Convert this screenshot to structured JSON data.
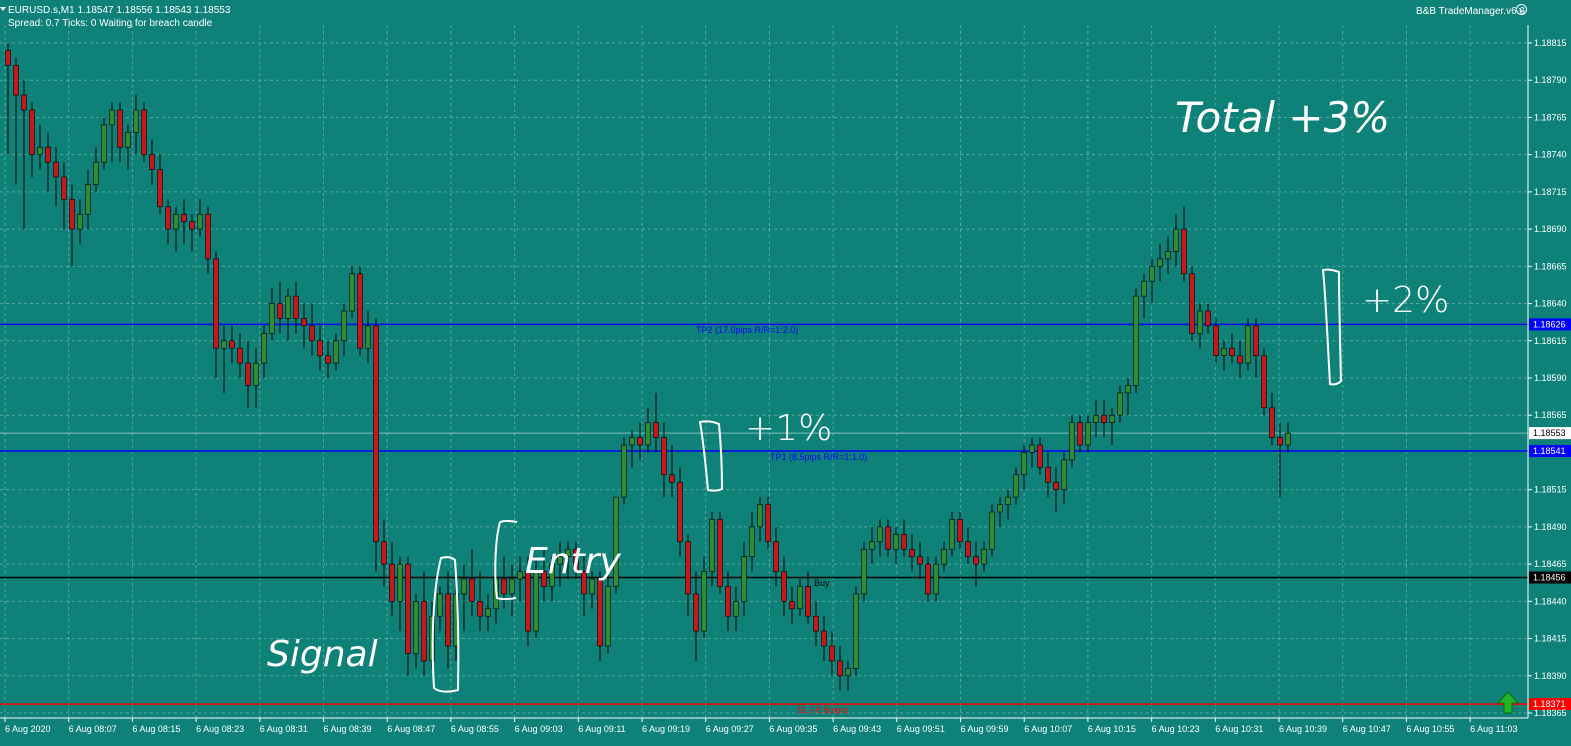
{
  "header": {
    "line1": "EURUSD.s,M1  1.18547 1.18556 1.18543 1.18553",
    "line2": "Spread: 0.7  Ticks: 0  Waiting for breach candle",
    "trade_manager": "B&B TradeManager.v6.6"
  },
  "colors": {
    "background": "#0e8279",
    "bull_candle": "#2e8b3a",
    "bear_candle": "#c8161d",
    "wick": "#000000",
    "grid": "#8fc7c0",
    "tp_line": "#0000ff",
    "sl_line": "#ff0000",
    "entry_line": "#000000",
    "handwriting": "#ffffff"
  },
  "price_axis": {
    "labels": [
      "1.18815",
      "1.18790",
      "1.18765",
      "1.18740",
      "1.18715",
      "1.18690",
      "1.18665",
      "1.18640",
      "1.18615",
      "1.18590",
      "1.18565",
      "1.18515",
      "1.18490",
      "1.18465",
      "1.18440",
      "1.18415",
      "1.18390",
      "1.18365"
    ],
    "top_price": 1.18815,
    "bottom_price": 1.18365
  },
  "time_axis": {
    "labels": [
      "6 Aug 2020",
      "6 Aug 08:07",
      "6 Aug 08:15",
      "6 Aug 08:23",
      "6 Aug 08:31",
      "6 Aug 08:39",
      "6 Aug 08:47",
      "6 Aug 08:55",
      "6 Aug 09:03",
      "6 Aug 09:11",
      "6 Aug 09:19",
      "6 Aug 09:27",
      "6 Aug 09:35",
      "6 Aug 09:43",
      "6 Aug 09:51",
      "6 Aug 09:59",
      "6 Aug 10:07",
      "6 Aug 10:15",
      "6 Aug 10:23",
      "6 Aug 10:31",
      "6 Aug 10:39",
      "6 Aug 10:47",
      "6 Aug 10:55",
      "6 Aug 11:03"
    ]
  },
  "levels": {
    "tp2": {
      "price": 1.18626,
      "price_label": "1.18626",
      "label": "TP2 (17.0pips R/R=1:2.0)"
    },
    "tp1": {
      "price": 1.18541,
      "price_label": "1.18541",
      "label": "TP1 (8.5pips R/R=1:1.0)"
    },
    "entry": {
      "price": 1.18456,
      "price_label": "1.18456",
      "label": "Buy"
    },
    "sl": {
      "price": 1.18371,
      "price_label": "1.18371",
      "label": "SL (-8.5pips)"
    },
    "current": {
      "price": 1.18553,
      "price_label": "1.18553"
    }
  },
  "annotations": {
    "total": "Total +3%",
    "tp2_gain": "+2%",
    "tp1_gain": "+1%",
    "entry": "Entry",
    "signal": "Signal"
  },
  "chart_data": {
    "type": "candlestick",
    "symbol": "EURUSD.s",
    "timeframe": "M1",
    "ohlc": [
      [
        1.1881,
        1.18815,
        1.1874,
        1.188
      ],
      [
        1.188,
        1.18805,
        1.1872,
        1.1878
      ],
      [
        1.1878,
        1.1879,
        1.1869,
        1.1877
      ],
      [
        1.1877,
        1.18775,
        1.18725,
        1.1874
      ],
      [
        1.1874,
        1.1876,
        1.1873,
        1.18745
      ],
      [
        1.18745,
        1.18755,
        1.18715,
        1.18735
      ],
      [
        1.18735,
        1.18745,
        1.18705,
        1.18725
      ],
      [
        1.18725,
        1.18735,
        1.1869,
        1.1871
      ],
      [
        1.1871,
        1.1872,
        1.18665,
        1.1869
      ],
      [
        1.1869,
        1.1871,
        1.1868,
        1.187
      ],
      [
        1.187,
        1.1873,
        1.1869,
        1.1872
      ],
      [
        1.1872,
        1.18745,
        1.18715,
        1.18735
      ],
      [
        1.18735,
        1.18765,
        1.1873,
        1.1876
      ],
      [
        1.1876,
        1.18775,
        1.18735,
        1.1877
      ],
      [
        1.1877,
        1.18775,
        1.18735,
        1.18745
      ],
      [
        1.18745,
        1.1876,
        1.1873,
        1.18755
      ],
      [
        1.18755,
        1.1878,
        1.1874,
        1.1877
      ],
      [
        1.1877,
        1.18775,
        1.18735,
        1.1874
      ],
      [
        1.1874,
        1.1875,
        1.1872,
        1.1873
      ],
      [
        1.1873,
        1.1874,
        1.187,
        1.18705
      ],
      [
        1.18705,
        1.1871,
        1.1868,
        1.1869
      ],
      [
        1.1869,
        1.18705,
        1.18675,
        1.187
      ],
      [
        1.187,
        1.1871,
        1.1868,
        1.18695
      ],
      [
        1.18695,
        1.187,
        1.18675,
        1.1869
      ],
      [
        1.1869,
        1.1871,
        1.18685,
        1.187
      ],
      [
        1.187,
        1.18705,
        1.1866,
        1.1867
      ],
      [
        1.1867,
        1.18675,
        1.1859,
        1.1861
      ],
      [
        1.1861,
        1.18625,
        1.1858,
        1.18615
      ],
      [
        1.18615,
        1.18625,
        1.186,
        1.1861
      ],
      [
        1.1861,
        1.1862,
        1.1859,
        1.186
      ],
      [
        1.186,
        1.18615,
        1.1857,
        1.18585
      ],
      [
        1.18585,
        1.1861,
        1.1857,
        1.186
      ],
      [
        1.186,
        1.18625,
        1.1859,
        1.1862
      ],
      [
        1.1862,
        1.1865,
        1.18615,
        1.1864
      ],
      [
        1.1864,
        1.18655,
        1.1862,
        1.1863
      ],
      [
        1.1863,
        1.1865,
        1.18615,
        1.18645
      ],
      [
        1.18645,
        1.18655,
        1.1862,
        1.1863
      ],
      [
        1.1863,
        1.1864,
        1.1861,
        1.18625
      ],
      [
        1.18625,
        1.1864,
        1.18605,
        1.18615
      ],
      [
        1.18615,
        1.18625,
        1.18595,
        1.18605
      ],
      [
        1.18605,
        1.18615,
        1.1859,
        1.186
      ],
      [
        1.186,
        1.1862,
        1.18595,
        1.18615
      ],
      [
        1.18615,
        1.1864,
        1.18605,
        1.18635
      ],
      [
        1.18635,
        1.18665,
        1.1863,
        1.1866
      ],
      [
        1.1866,
        1.18665,
        1.18605,
        1.1861
      ],
      [
        1.1861,
        1.18635,
        1.186,
        1.18625
      ],
      [
        1.18625,
        1.1863,
        1.1846,
        1.1848
      ],
      [
        1.1848,
        1.18495,
        1.1845,
        1.18465
      ],
      [
        1.18465,
        1.1848,
        1.1843,
        1.1844
      ],
      [
        1.1844,
        1.1847,
        1.1842,
        1.18465
      ],
      [
        1.18465,
        1.1847,
        1.1839,
        1.18405
      ],
      [
        1.18405,
        1.18445,
        1.18395,
        1.1844
      ],
      [
        1.1844,
        1.1846,
        1.1839,
        1.184
      ],
      [
        1.184,
        1.1844,
        1.18395,
        1.1843
      ],
      [
        1.1843,
        1.1845,
        1.1842,
        1.18445
      ],
      [
        1.18445,
        1.1846,
        1.18395,
        1.1841
      ],
      [
        1.1841,
        1.1845,
        1.184,
        1.18445
      ],
      [
        1.18445,
        1.18465,
        1.1842,
        1.18455
      ],
      [
        1.18455,
        1.18475,
        1.1843,
        1.1844
      ],
      [
        1.1844,
        1.1846,
        1.1842,
        1.1843
      ],
      [
        1.1843,
        1.18445,
        1.1842,
        1.18435
      ],
      [
        1.18435,
        1.1846,
        1.18425,
        1.18455
      ],
      [
        1.18455,
        1.1847,
        1.18435,
        1.18445
      ],
      [
        1.18445,
        1.18465,
        1.1843,
        1.18455
      ],
      [
        1.18455,
        1.1847,
        1.1844,
        1.1846
      ],
      [
        1.1846,
        1.1847,
        1.1841,
        1.1842
      ],
      [
        1.1842,
        1.1847,
        1.18415,
        1.1846
      ],
      [
        1.1846,
        1.18475,
        1.1844,
        1.1845
      ],
      [
        1.1845,
        1.1847,
        1.1844,
        1.18465
      ],
      [
        1.18465,
        1.1848,
        1.1845,
        1.1847
      ],
      [
        1.1847,
        1.1848,
        1.18455,
        1.18475
      ],
      [
        1.18475,
        1.1848,
        1.18455,
        1.1846
      ],
      [
        1.1846,
        1.1847,
        1.1843,
        1.18445
      ],
      [
        1.18445,
        1.1846,
        1.18435,
        1.18455
      ],
      [
        1.18455,
        1.1846,
        1.184,
        1.1841
      ],
      [
        1.1841,
        1.1846,
        1.18405,
        1.1845
      ],
      [
        1.1845,
        1.1851,
        1.18445,
        1.1851
      ],
      [
        1.1851,
        1.1855,
        1.18505,
        1.18545
      ],
      [
        1.18545,
        1.18555,
        1.1853,
        1.1855
      ],
      [
        1.1855,
        1.1856,
        1.18535,
        1.18545
      ],
      [
        1.18545,
        1.1857,
        1.1854,
        1.1856
      ],
      [
        1.1856,
        1.1858,
        1.1854,
        1.1855
      ],
      [
        1.1855,
        1.1856,
        1.1851,
        1.18525
      ],
      [
        1.18525,
        1.18545,
        1.1851,
        1.1852
      ],
      [
        1.1852,
        1.1853,
        1.1847,
        1.1848
      ],
      [
        1.1848,
        1.18485,
        1.1843,
        1.18445
      ],
      [
        1.18445,
        1.1846,
        1.184,
        1.1842
      ],
      [
        1.1842,
        1.1847,
        1.18415,
        1.1846
      ],
      [
        1.1846,
        1.185,
        1.1845,
        1.18495
      ],
      [
        1.18495,
        1.185,
        1.18445,
        1.1845
      ],
      [
        1.1845,
        1.1846,
        1.1842,
        1.1843
      ],
      [
        1.1843,
        1.1845,
        1.1842,
        1.1844
      ],
      [
        1.1844,
        1.1848,
        1.1843,
        1.1847
      ],
      [
        1.1847,
        1.185,
        1.1846,
        1.1849
      ],
      [
        1.1849,
        1.1851,
        1.1848,
        1.18505
      ],
      [
        1.18505,
        1.1851,
        1.18475,
        1.1848
      ],
      [
        1.1848,
        1.1849,
        1.1845,
        1.1846
      ],
      [
        1.1846,
        1.1847,
        1.1843,
        1.1844
      ],
      [
        1.1844,
        1.1845,
        1.18425,
        1.18435
      ],
      [
        1.18435,
        1.18455,
        1.1843,
        1.1845
      ],
      [
        1.1845,
        1.1846,
        1.18425,
        1.1843
      ],
      [
        1.1843,
        1.1844,
        1.1841,
        1.1842
      ],
      [
        1.1842,
        1.1843,
        1.184,
        1.1841
      ],
      [
        1.1841,
        1.1842,
        1.1839,
        1.184
      ],
      [
        1.184,
        1.1841,
        1.1838,
        1.1839
      ],
      [
        1.1839,
        1.184,
        1.1838,
        1.18395
      ],
      [
        1.18395,
        1.1845,
        1.1839,
        1.18445
      ],
      [
        1.18445,
        1.1848,
        1.1844,
        1.18475
      ],
      [
        1.18475,
        1.1849,
        1.18465,
        1.1848
      ],
      [
        1.1848,
        1.18495,
        1.1847,
        1.1849
      ],
      [
        1.1849,
        1.18495,
        1.1847,
        1.18475
      ],
      [
        1.18475,
        1.1849,
        1.18465,
        1.18485
      ],
      [
        1.18485,
        1.18495,
        1.1847,
        1.18475
      ],
      [
        1.18475,
        1.18485,
        1.1846,
        1.1847
      ],
      [
        1.1847,
        1.1848,
        1.18455,
        1.18465
      ],
      [
        1.18465,
        1.1847,
        1.1844,
        1.18445
      ],
      [
        1.18445,
        1.1847,
        1.1844,
        1.18465
      ],
      [
        1.18465,
        1.1848,
        1.1846,
        1.18475
      ],
      [
        1.18475,
        1.185,
        1.1847,
        1.18495
      ],
      [
        1.18495,
        1.185,
        1.18475,
        1.1848
      ],
      [
        1.1848,
        1.1849,
        1.18465,
        1.1847
      ],
      [
        1.1847,
        1.1848,
        1.1845,
        1.18465
      ],
      [
        1.18465,
        1.1848,
        1.1846,
        1.18475
      ],
      [
        1.18475,
        1.18505,
        1.1847,
        1.185
      ],
      [
        1.185,
        1.1851,
        1.1849,
        1.18505
      ],
      [
        1.18505,
        1.18515,
        1.18495,
        1.1851
      ],
      [
        1.1851,
        1.1853,
        1.18505,
        1.18525
      ],
      [
        1.18525,
        1.18545,
        1.18515,
        1.1854
      ],
      [
        1.1854,
        1.1855,
        1.1853,
        1.18545
      ],
      [
        1.18545,
        1.1855,
        1.18525,
        1.1853
      ],
      [
        1.1853,
        1.1854,
        1.1851,
        1.1852
      ],
      [
        1.1852,
        1.1853,
        1.185,
        1.18515
      ],
      [
        1.18515,
        1.1854,
        1.18505,
        1.18535
      ],
      [
        1.18535,
        1.18565,
        1.1853,
        1.1856
      ],
      [
        1.1856,
        1.18565,
        1.1854,
        1.18545
      ],
      [
        1.18545,
        1.18565,
        1.1854,
        1.1856
      ],
      [
        1.1856,
        1.18575,
        1.1855,
        1.18565
      ],
      [
        1.18565,
        1.18575,
        1.1855,
        1.1856
      ],
      [
        1.1856,
        1.1857,
        1.18545,
        1.18565
      ],
      [
        1.18565,
        1.18585,
        1.1856,
        1.1858
      ],
      [
        1.1858,
        1.1859,
        1.18565,
        1.18585
      ],
      [
        1.18585,
        1.1865,
        1.1858,
        1.18645
      ],
      [
        1.18645,
        1.1866,
        1.1863,
        1.18655
      ],
      [
        1.18655,
        1.1867,
        1.1864,
        1.18665
      ],
      [
        1.18665,
        1.1868,
        1.18655,
        1.1867
      ],
      [
        1.1867,
        1.18685,
        1.1866,
        1.18675
      ],
      [
        1.18675,
        1.187,
        1.18665,
        1.1869
      ],
      [
        1.1869,
        1.18705,
        1.18655,
        1.1866
      ],
      [
        1.1866,
        1.18665,
        1.18615,
        1.1862
      ],
      [
        1.1862,
        1.1864,
        1.1861,
        1.18635
      ],
      [
        1.18635,
        1.1864,
        1.1862,
        1.18625
      ],
      [
        1.18625,
        1.1863,
        1.186,
        1.18605
      ],
      [
        1.18605,
        1.18615,
        1.18595,
        1.1861
      ],
      [
        1.1861,
        1.1862,
        1.186,
        1.18605
      ],
      [
        1.18605,
        1.18615,
        1.1859,
        1.186
      ],
      [
        1.186,
        1.1863,
        1.18595,
        1.18625
      ],
      [
        1.18625,
        1.1863,
        1.1859,
        1.18605
      ],
      [
        1.18605,
        1.1861,
        1.18565,
        1.1857
      ],
      [
        1.1857,
        1.1858,
        1.18545,
        1.1855
      ],
      [
        1.1855,
        1.1856,
        1.1851,
        1.18545
      ],
      [
        1.18545,
        1.1856,
        1.1854,
        1.18553
      ]
    ]
  }
}
